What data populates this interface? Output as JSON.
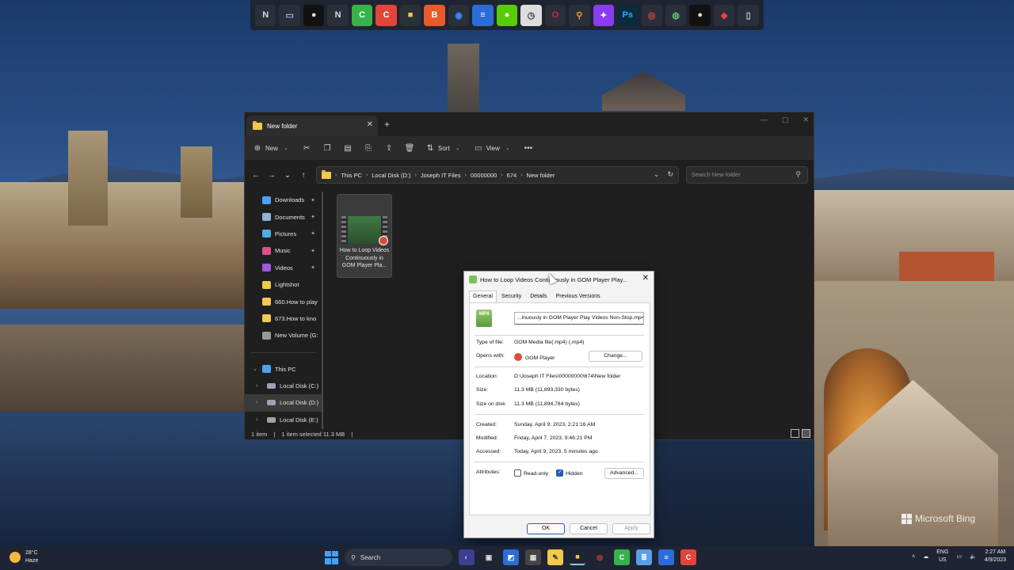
{
  "dock": {
    "icons": [
      {
        "name": "nexus-icon",
        "glyph": "N",
        "bg": "#2a2f3a",
        "color": "#ddd"
      },
      {
        "name": "monitor-icon",
        "glyph": "▭",
        "bg": "#2a2f3a",
        "color": "#7fb8ff"
      },
      {
        "name": "obs-icon",
        "glyph": "●",
        "bg": "#111",
        "color": "#ddd"
      },
      {
        "name": "nexus-icon-2",
        "glyph": "N",
        "bg": "#2a2f3a",
        "color": "#ddd"
      },
      {
        "name": "camtasia-green-icon",
        "glyph": "C",
        "bg": "#36b24a",
        "color": "#fff"
      },
      {
        "name": "camtasia-red-icon",
        "glyph": "C",
        "bg": "#e2453a",
        "color": "#fff"
      },
      {
        "name": "folder-icon",
        "glyph": "■",
        "bg": "#2a2f3a",
        "color": "#f2c94c"
      },
      {
        "name": "brave-icon",
        "glyph": "B",
        "bg": "#e85a2a",
        "color": "#fff"
      },
      {
        "name": "firefox-icon",
        "glyph": "◉",
        "bg": "#2a2f3a",
        "color": "#3a8cff"
      },
      {
        "name": "docs-icon",
        "glyph": "≡",
        "bg": "#2b6cd6",
        "color": "#fff"
      },
      {
        "name": "duo-icon",
        "glyph": "●",
        "bg": "#58cc02",
        "color": "#fff"
      },
      {
        "name": "clock-icon",
        "glyph": "◷",
        "bg": "#ddd",
        "color": "#333"
      },
      {
        "name": "opera-icon",
        "glyph": "O",
        "bg": "#2a2f3a",
        "color": "#d9233c"
      },
      {
        "name": "search-tool-icon",
        "glyph": "⚲",
        "bg": "#2a2f3a",
        "color": "#f0a030"
      },
      {
        "name": "messenger-icon",
        "glyph": "✦",
        "bg": "#8a3cf0",
        "color": "#fff"
      },
      {
        "name": "photoshop-icon",
        "glyph": "Ps",
        "bg": "#0b2a3c",
        "color": "#31a8ff"
      },
      {
        "name": "chrome-icon",
        "glyph": "◎",
        "bg": "#2a2f3a",
        "color": "#e8453c"
      },
      {
        "name": "globe-icon",
        "glyph": "◍",
        "bg": "#2a2f3a",
        "color": "#5cc16a"
      },
      {
        "name": "obs-icon-2",
        "glyph": "●",
        "bg": "#111",
        "color": "#ddd"
      },
      {
        "name": "paint-icon",
        "glyph": "◆",
        "bg": "#2a2f3a",
        "color": "#e8453c"
      },
      {
        "name": "recycle-bin-icon",
        "glyph": "▯",
        "bg": "#2a2f3a",
        "color": "#ccc"
      }
    ]
  },
  "explorer": {
    "tab_title": "New folder",
    "toolbar": {
      "new_label": "New",
      "sort_label": "Sort",
      "view_label": "View"
    },
    "breadcrumb": [
      "This PC",
      "Local Disk (D:)",
      "Joseph IT Files",
      "00000000",
      "674",
      "New folder"
    ],
    "search_placeholder": "Search New folder",
    "sidebar": {
      "quick": [
        {
          "label": "Downloads",
          "color": "#4aa3f0",
          "pinned": true
        },
        {
          "label": "Documents",
          "color": "#8fb4d8",
          "pinned": true
        },
        {
          "label": "Pictures",
          "color": "#4ab0e8",
          "pinned": true
        },
        {
          "label": "Music",
          "color": "#e0508a",
          "pinned": true
        },
        {
          "label": "Videos",
          "color": "#9a5ad8",
          "pinned": true
        },
        {
          "label": "Lightshot",
          "color": "#f2c94c",
          "pinned": false
        },
        {
          "label": "660.How to play",
          "color": "#f2c94c",
          "pinned": false
        },
        {
          "label": "673.How to kno",
          "color": "#f2c94c",
          "pinned": false
        },
        {
          "label": "New Volume (G:",
          "color": "#999",
          "pinned": false
        }
      ],
      "this_pc_label": "This PC",
      "drives": [
        "Local Disk (C:)",
        "Local Disk (D:)",
        "Local Disk (E:)"
      ]
    },
    "file": {
      "name": "How to Loop Videos Continuously in GOM Player Pla..."
    },
    "status": {
      "count": "1 item",
      "selected": "1 item selected  11.3 MB"
    }
  },
  "dialog": {
    "title": "How to Loop Videos Continuously in GOM Player Play...",
    "tabs": [
      "General",
      "Security",
      "Details",
      "Previous Versions"
    ],
    "active_tab": "General",
    "file_icon_text": "MP4",
    "file_name_field": "...inuously in GOM Player Play Videos Non-Stop.mp4",
    "type_label": "Type of file:",
    "type_value": "GOM Media file(.mp4) (.mp4)",
    "opens_label": "Opens with:",
    "opens_value": "GOM Player",
    "change_label": "Change...",
    "location_label": "Location:",
    "location_value": "D:\\Joseph IT Files\\00000000\\674\\New folder",
    "size_label": "Size:",
    "size_value": "11.3 MB (11,893,330 bytes)",
    "size_disk_label": "Size on disk:",
    "size_disk_value": "11.3 MB (11,894,784 bytes)",
    "created_label": "Created:",
    "created_value": "Sunday, April 9, 2023, 2:21:16 AM",
    "modified_label": "Modified:",
    "modified_value": "Friday, April 7, 2023, 9:46:21 PM",
    "accessed_label": "Accessed:",
    "accessed_value": "Today, April 9, 2023, 5 minutes ago",
    "attributes_label": "Attributes:",
    "readonly_label": "Read-only",
    "readonly_checked": false,
    "hidden_label": "Hidden",
    "hidden_checked": true,
    "advanced_label": "Advanced...",
    "ok_label": "OK",
    "cancel_label": "Cancel",
    "apply_label": "Apply"
  },
  "wallpaper": {
    "brand": "Microsoft Bing"
  },
  "taskbar": {
    "weather_temp": "28°C",
    "weather_desc": "Haze",
    "search_label": "Search",
    "apps": [
      {
        "name": "copilot-icon",
        "glyph": "◐",
        "bg": "#3b3f8f",
        "color": "#c9a0ff",
        "active": false
      },
      {
        "name": "task-view-icon",
        "glyph": "▣",
        "bg": "transparent",
        "color": "#ddd",
        "active": false
      },
      {
        "name": "code-editor-icon",
        "glyph": "◩",
        "bg": "#2b6cd6",
        "color": "#fff",
        "active": false
      },
      {
        "name": "calculator-icon",
        "glyph": "▦",
        "bg": "#444",
        "color": "#ddd",
        "active": false
      },
      {
        "name": "sticky-notes-icon",
        "glyph": "✎",
        "bg": "#f2c94c",
        "color": "#333",
        "active": false
      },
      {
        "name": "file-explorer-icon",
        "glyph": "■",
        "bg": "transparent",
        "color": "#f2c94c",
        "active": true
      },
      {
        "name": "chrome-icon",
        "glyph": "◎",
        "bg": "transparent",
        "color": "#e8453c",
        "active": false
      },
      {
        "name": "camtasia-icon",
        "glyph": "C",
        "bg": "#36b24a",
        "color": "#fff",
        "active": false
      },
      {
        "name": "notepad-icon",
        "glyph": "≣",
        "bg": "#5aa0e8",
        "color": "#fff",
        "active": false
      },
      {
        "name": "docs-icon",
        "glyph": "≡",
        "bg": "#2b6cd6",
        "color": "#fff",
        "active": false
      },
      {
        "name": "camtasia-red-icon",
        "glyph": "C",
        "bg": "#e2453a",
        "color": "#fff",
        "active": false
      }
    ],
    "lang_top": "ENG",
    "lang_bottom": "US",
    "time": "2:27 AM",
    "date": "4/9/2023"
  }
}
